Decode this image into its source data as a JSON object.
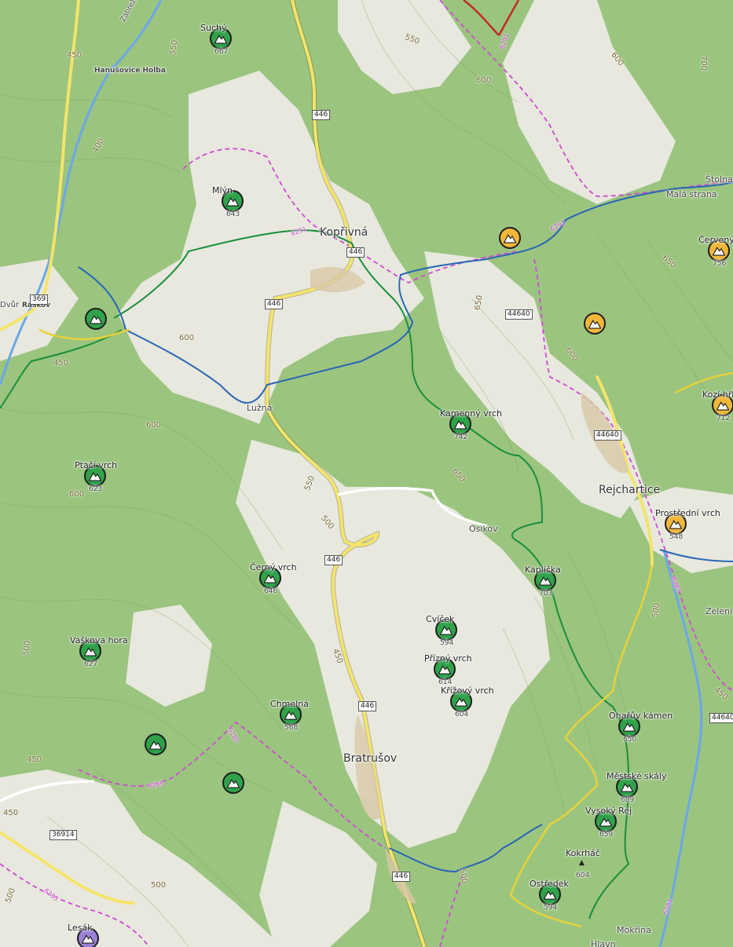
{
  "colors": {
    "forest": "#9bc47f",
    "open": "#eaeaea",
    "road_yellow": "#f4e46a",
    "trail_green": "#1a8f3c",
    "trail_blue": "#2866b5",
    "trail_yellow": "#e7d23a",
    "boundary": "#d04ad4",
    "river": "#6aa8e8",
    "marker_green": "#2fa24a",
    "marker_yellow": "#f1b73b",
    "marker_purple": "#9b7fd6"
  },
  "places": {
    "koprivna": "Kopřivná",
    "bratrusov": "Bratrušov",
    "rejchartice": "Rejchartice",
    "luzna": "Lužná",
    "osikov": "Osikov",
    "hanusovice": "Hanušovice Holba",
    "raskov": "Raškov",
    "dvur": "Dvůr",
    "zabrezska": "Zábřežská",
    "mala_strana": "Malá strana",
    "stolna": "Štolna",
    "zeleni": "Zeleni",
    "mokrina": "Mokřina",
    "hlavn": "Hlavn"
  },
  "peaks": [
    {
      "id": "suchy",
      "name": "Suchý",
      "elev": "667",
      "kind": "green"
    },
    {
      "id": "mlyn",
      "name": "Mlýn",
      "elev": "643",
      "kind": "green"
    },
    {
      "id": "raskov-peak",
      "name": "",
      "elev": "",
      "kind": "green"
    },
    {
      "id": "ptaci-vrch",
      "name": "Ptačí vrch",
      "elev": "623",
      "kind": "green"
    },
    {
      "id": "vaskova-hora",
      "name": "Vaškova hora",
      "elev": "627",
      "kind": "green"
    },
    {
      "id": "cerny-vrch",
      "name": "Černý vrch",
      "elev": "646",
      "kind": "green"
    },
    {
      "id": "chmelna",
      "name": "Chmelná",
      "elev": "568",
      "kind": "green"
    },
    {
      "id": "unnamed-1",
      "name": "",
      "elev": "",
      "kind": "green"
    },
    {
      "id": "unnamed-2",
      "name": "",
      "elev": "",
      "kind": "green"
    },
    {
      "id": "peak-742",
      "name": "Kamenný vrch",
      "elev": "742",
      "kind": "green"
    },
    {
      "id": "kaplicka",
      "name": "Kaplička",
      "elev": "703",
      "kind": "green"
    },
    {
      "id": "cvicek",
      "name": "Cvíček",
      "elev": "594",
      "kind": "green"
    },
    {
      "id": "prizny-vrch",
      "name": "Přízný vrch",
      "elev": "614",
      "kind": "green"
    },
    {
      "id": "krizovy-vrch",
      "name": "Křížový vrch",
      "elev": "604",
      "kind": "green"
    },
    {
      "id": "oharuv-kamen",
      "name": "Ohařův kámen",
      "elev": "650",
      "kind": "green"
    },
    {
      "id": "mestske-skaly",
      "name": "Městské skály",
      "elev": "689",
      "kind": "green"
    },
    {
      "id": "vysoky-rej",
      "name": "Vysoký Rej",
      "elev": "659",
      "kind": "green"
    },
    {
      "id": "ostredek",
      "name": "Ostředek",
      "elev": "594",
      "kind": "green"
    },
    {
      "id": "yellow-1",
      "name": "",
      "elev": "",
      "kind": "yellow"
    },
    {
      "id": "yellow-2",
      "name": "",
      "elev": "",
      "kind": "yellow"
    },
    {
      "id": "cerveny-vrch",
      "name": "Červený vrch",
      "elev": "756",
      "kind": "yellow"
    },
    {
      "id": "kozi-hrbet",
      "name": "Kozí hřbet",
      "elev": "712",
      "kind": "yellow"
    },
    {
      "id": "prostredni-vrch",
      "name": "Prostřední vrch",
      "elev": "548",
      "kind": "yellow"
    },
    {
      "id": "lesak",
      "name": "Lesák",
      "elev": "",
      "kind": "purple"
    }
  ],
  "kokrhac": {
    "name": "Kokrháč",
    "elev": "604"
  },
  "road_numbers": [
    "446",
    "446",
    "446",
    "446",
    "446",
    "446",
    "369",
    "44640",
    "44640",
    "44640",
    "36914"
  ],
  "boundary_codes": [
    "6291",
    "6291",
    "6291",
    "6285",
    "6285",
    "6285",
    "6287",
    "6284"
  ],
  "contours": [
    "450",
    "400",
    "450",
    "600",
    "600",
    "600",
    "550",
    "500",
    "550",
    "650",
    "650",
    "600",
    "650",
    "600",
    "500",
    "450",
    "450",
    "500",
    "450",
    "500",
    "500",
    "550",
    "600",
    "700",
    "500",
    "450"
  ]
}
